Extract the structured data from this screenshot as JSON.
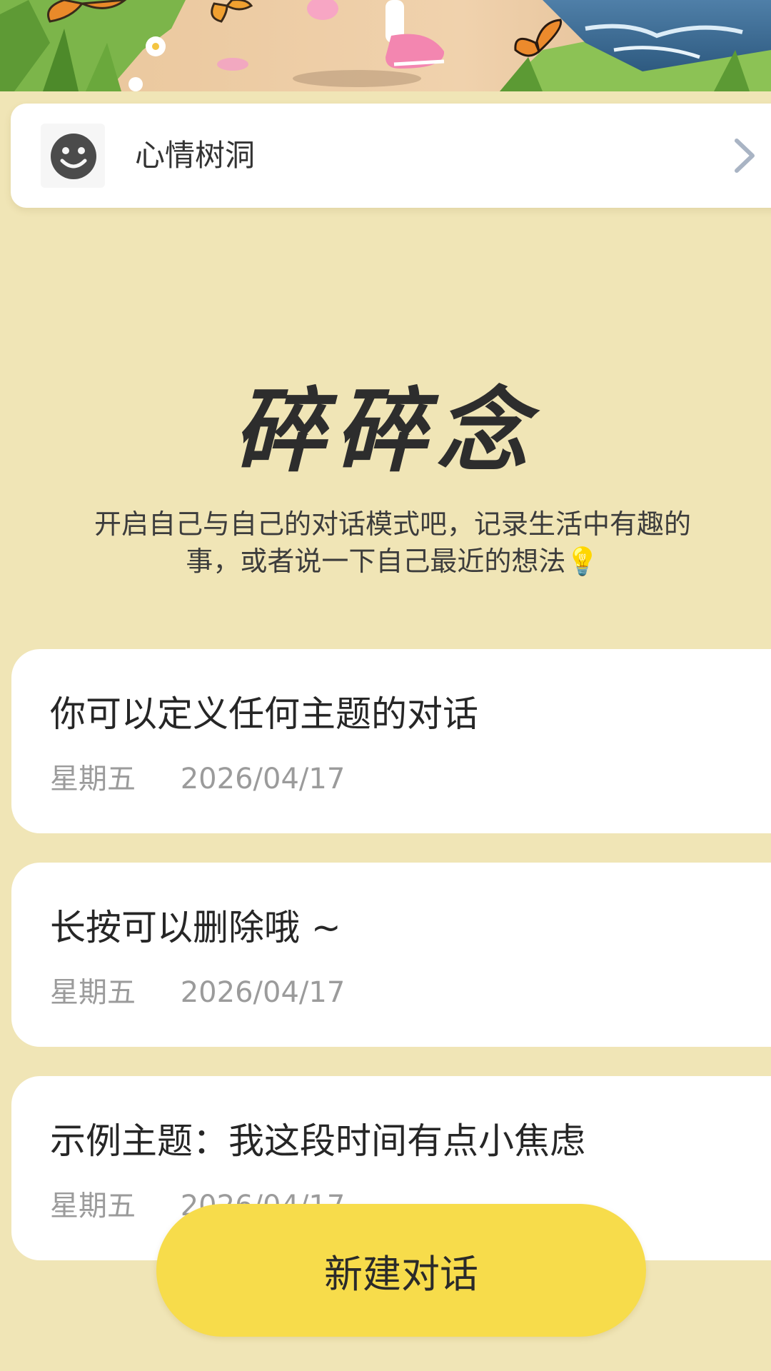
{
  "entry": {
    "label": "心情树洞",
    "icon": "smiley-face-icon"
  },
  "headline": {
    "title": "碎碎念",
    "subtitle": "开启自己与自己的对话模式吧，记录生活中有趣的事，或者说一下自己最近的想法💡"
  },
  "conversations": [
    {
      "title": "你可以定义任何主题的对话",
      "weekday": "星期五",
      "date": "2026/04/17"
    },
    {
      "title": "长按可以删除哦 ~",
      "weekday": "星期五",
      "date": "2026/04/17"
    },
    {
      "title": "示例主题：我这段时间有点小焦虑",
      "weekday": "星期五",
      "date": "2026/04/17"
    }
  ],
  "actions": {
    "new_conversation": "新建对话"
  },
  "colors": {
    "background": "#f0e5b6",
    "card": "#ffffff",
    "accent_button": "#f7dc4b",
    "meta_text": "#9b9b9b"
  }
}
